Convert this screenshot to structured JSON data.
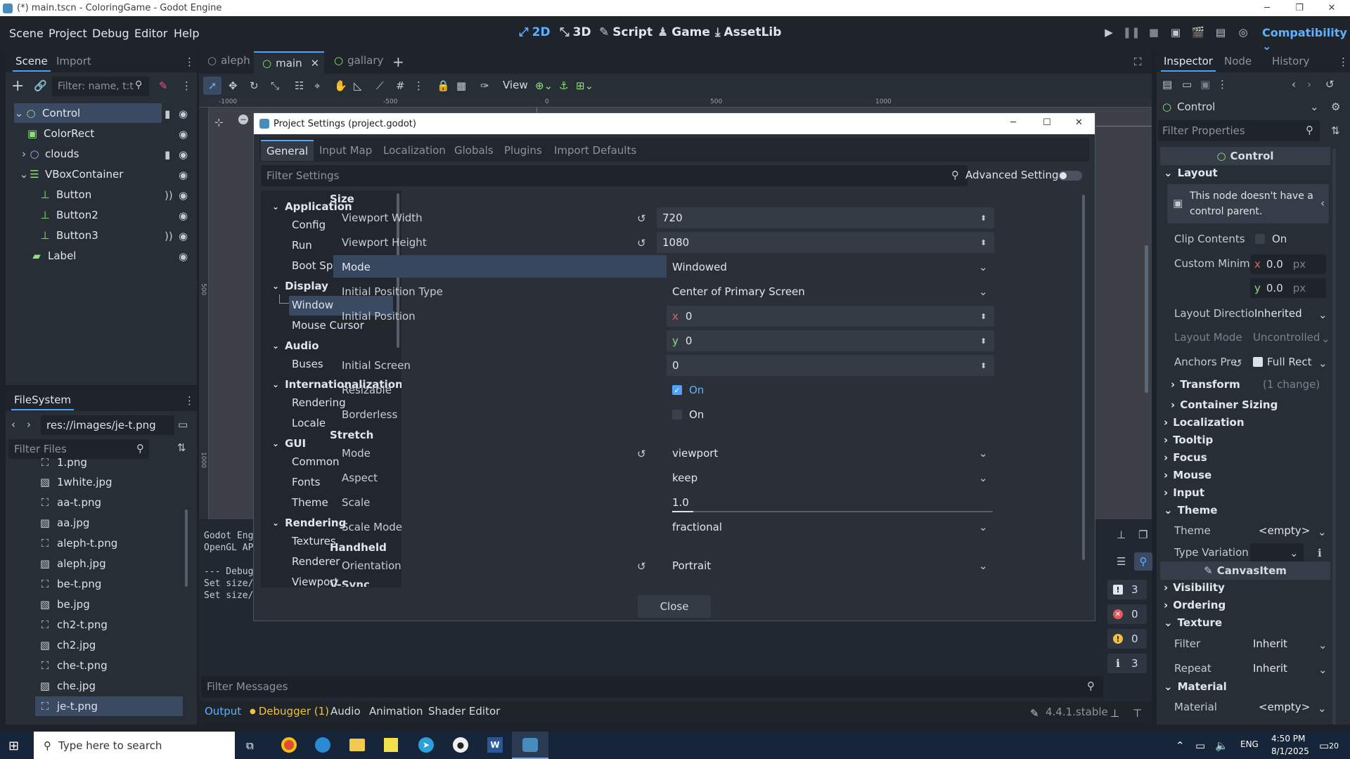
{
  "window": {
    "title": "(*) main.tscn - ColoringGame - Godot Engine"
  },
  "menu": [
    "Scene",
    "Project",
    "Debug",
    "Editor",
    "Help"
  ],
  "workspaces": [
    "2D",
    "3D",
    "Script",
    "Game",
    "AssetLib"
  ],
  "renderer": "Compatibility",
  "scene_dock": {
    "tabs": [
      "Scene",
      "Import"
    ],
    "filter_placeholder": "Filter: name, t:t",
    "nodes": [
      {
        "name": "Control"
      },
      {
        "name": "ColorRect"
      },
      {
        "name": "clouds"
      },
      {
        "name": "VBoxContainer"
      },
      {
        "name": "Button"
      },
      {
        "name": "Button2"
      },
      {
        "name": "Button3"
      },
      {
        "name": "Label"
      }
    ]
  },
  "filesystem": {
    "title": "FileSystem",
    "path": "res://images/je-t.png",
    "filter_placeholder": "Filter Files",
    "files": [
      "1.png",
      "1white.jpg",
      "aa-t.png",
      "aa.jpg",
      "aleph-t.png",
      "aleph.jpg",
      "be-t.png",
      "be.jpg",
      "ch2-t.png",
      "ch2.jpg",
      "che-t.png",
      "che.jpg",
      "je-t.png"
    ]
  },
  "scene_tabs": [
    "aleph",
    "main",
    "gallary"
  ],
  "toolbar": {
    "view_label": "View"
  },
  "ruler_labels": [
    "-1000",
    "-500",
    "0",
    "500",
    "1000"
  ],
  "ruler_v_labels": [
    "500",
    "1000"
  ],
  "output": {
    "lines": [
      "Godot Eng",
      "OpenGL AP",
      "",
      "--- Debug",
      "Set size/",
      "Set size/"
    ],
    "filter_placeholder": "Filter Messages",
    "counts": [
      "3",
      "0",
      "0",
      "3"
    ]
  },
  "bottom_tabs": [
    "Output",
    "Debugger (1)",
    "Audio",
    "Animation",
    "Shader Editor"
  ],
  "version": "4.4.1.stable",
  "dialog": {
    "title": "Project Settings (project.godot)",
    "tabs": [
      "General",
      "Input Map",
      "Localization",
      "Globals",
      "Plugins",
      "Import Defaults"
    ],
    "filter_placeholder": "Filter Settings",
    "advanced_label": "Advanced Settings",
    "categories": [
      {
        "name": "Application",
        "items": [
          "Config",
          "Run",
          "Boot Splash"
        ]
      },
      {
        "name": "Display",
        "items": [
          "Window",
          "Mouse Cursor"
        ]
      },
      {
        "name": "Audio",
        "items": [
          "Buses"
        ]
      },
      {
        "name": "Internationalization",
        "items": [
          "Rendering",
          "Locale"
        ]
      },
      {
        "name": "GUI",
        "items": [
          "Common",
          "Fonts",
          "Theme"
        ]
      },
      {
        "name": "Rendering",
        "items": [
          "Textures",
          "Renderer",
          "Viewport"
        ]
      }
    ],
    "sections": {
      "size": "Size",
      "stretch": "Stretch",
      "handheld": "Handheld",
      "vsync": "V-Sync"
    },
    "props": {
      "viewport_width": {
        "label": "Viewport Width",
        "value": "720"
      },
      "viewport_height": {
        "label": "Viewport Height",
        "value": "1080"
      },
      "mode": {
        "label": "Mode",
        "value": "Windowed"
      },
      "initial_position_type": {
        "label": "Initial Position Type",
        "value": "Center of Primary Screen"
      },
      "initial_position": {
        "label": "Initial Position",
        "x": "0",
        "y": "0"
      },
      "initial_screen": {
        "label": "Initial Screen",
        "value": "0"
      },
      "resizable": {
        "label": "Resizable",
        "value": "On",
        "checked": true
      },
      "borderless": {
        "label": "Borderless",
        "value": "On",
        "checked": false
      },
      "stretch_mode": {
        "label": "Mode",
        "value": "viewport"
      },
      "aspect": {
        "label": "Aspect",
        "value": "keep"
      },
      "scale": {
        "label": "Scale",
        "value": "1.0"
      },
      "scale_mode": {
        "label": "Scale Mode",
        "value": "fractional"
      },
      "orientation": {
        "label": "Orientation",
        "value": "Portrait"
      }
    },
    "close_label": "Close"
  },
  "inspector": {
    "tabs": [
      "Inspector",
      "Node",
      "History"
    ],
    "node": "Control",
    "filter_placeholder": "Filter Properties",
    "class_header": "Control",
    "layout": "Layout",
    "warning": "This node doesn't have a control parent.",
    "clip_contents": {
      "label": "Clip Contents",
      "value": "On"
    },
    "custom_min": {
      "label": "Custom Minim",
      "x": "0.0",
      "y": "0.0",
      "unit": "px"
    },
    "layout_direction": {
      "label": "Layout Directio",
      "value": "Inherited"
    },
    "layout_mode": {
      "label": "Layout Mode",
      "value": "Uncontrolled"
    },
    "anchors": {
      "label": "Anchors Pre",
      "value": "Full Rect"
    },
    "transform": {
      "label": "Transform",
      "note": "(1 change)"
    },
    "container_sizing": "Container Sizing",
    "groups": [
      "Localization",
      "Tooltip",
      "Focus",
      "Mouse",
      "Input"
    ],
    "theme_group": "Theme",
    "theme": {
      "label": "Theme",
      "value": "<empty>"
    },
    "type_variation": {
      "label": "Type Variation"
    },
    "canvas_item": "CanvasItem",
    "groups2": [
      "Visibility",
      "Ordering"
    ],
    "texture_group": "Texture",
    "filter": {
      "label": "Filter",
      "value": "Inherit"
    },
    "repeat": {
      "label": "Repeat",
      "value": "Inherit"
    },
    "material_group": "Material",
    "material": {
      "label": "Material",
      "value": "<empty>"
    }
  },
  "taskbar": {
    "search_placeholder": "Type here to search",
    "lang": "ENG",
    "time": "4:50 PM",
    "date": "8/1/2025",
    "notif_count": "20"
  },
  "colors": {
    "accent": "#4da3ff",
    "selection": "#3a4a63",
    "green_node": "#8ee07c",
    "bg": "#1d2229"
  }
}
